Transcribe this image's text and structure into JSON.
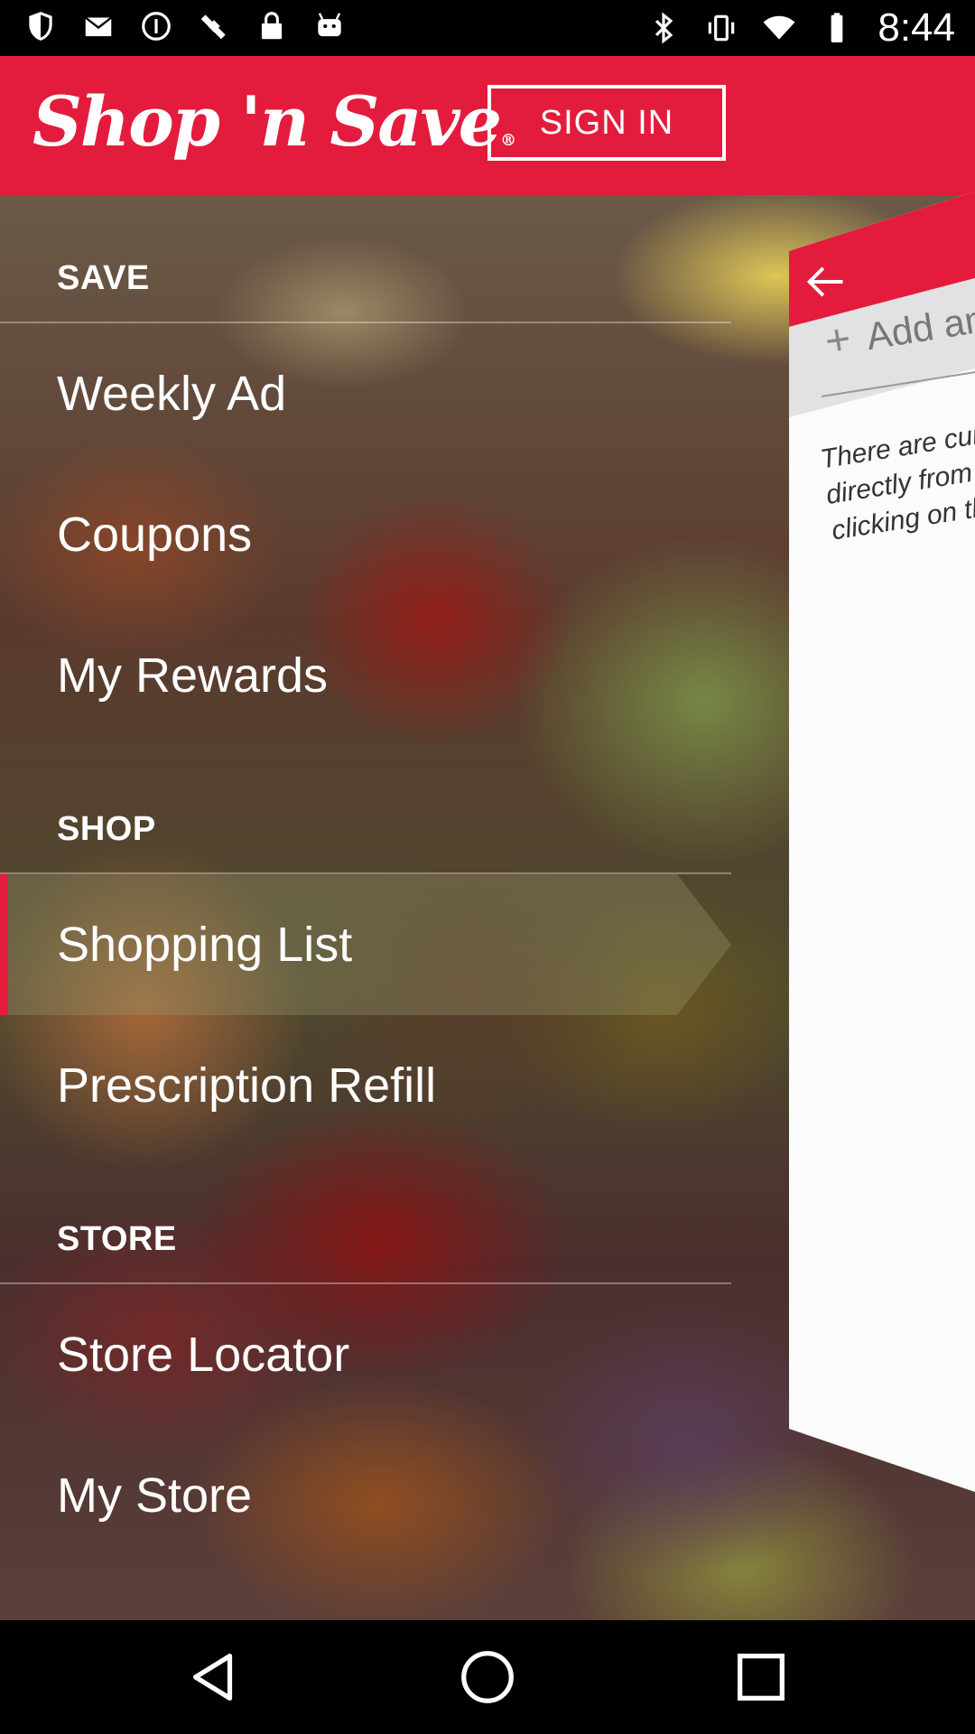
{
  "status_bar": {
    "time": "8:44",
    "icons_left": [
      "shield-icon",
      "mail-icon",
      "info-icon",
      "fake-gps-icon",
      "lock-icon",
      "android-icon"
    ],
    "icons_right": [
      "bluetooth-icon",
      "vibrate-icon",
      "wifi-icon",
      "battery-icon"
    ]
  },
  "app_bar": {
    "logo_text": "Shop 'n Save",
    "logo_mark": "®",
    "sign_in_label": "SIGN IN",
    "color": "#e31c3d"
  },
  "menu": {
    "sections": [
      {
        "header": "SAVE",
        "items": [
          "Weekly Ad",
          "Coupons",
          "My Rewards"
        ]
      },
      {
        "header": "SHOP",
        "items": [
          "Shopping List",
          "Prescription Refill"
        ]
      },
      {
        "header": "STORE",
        "items": [
          "Store Locator",
          "My Store"
        ]
      }
    ],
    "selected_item": "Shopping List"
  },
  "list_panel": {
    "add_placeholder": "Add an",
    "empty_message_lines": [
      "There are curr",
      "directly from t",
      "clicking on th"
    ]
  },
  "nav_bar": {
    "buttons": [
      "back-icon",
      "home-icon",
      "recents-icon"
    ]
  }
}
